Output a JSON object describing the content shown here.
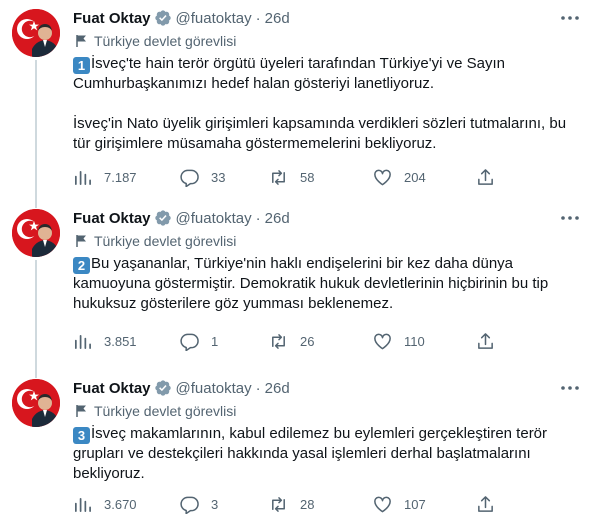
{
  "tweets": [
    {
      "name": "Fuat Oktay",
      "handle": "@fuatoktay",
      "separator": "·",
      "time": "26d",
      "label": "Türkiye devlet görevlisi",
      "number_badge": "1",
      "paragraphs": [
        "İsveç'te hain terör örgütü üyeleri tarafından Türkiye'yi ve Sayın Cumhurbaşkanımızı hedef halan gösteriyi lanetliyoruz.",
        "İsveç'in Nato üyelik girişimleri kapsamında verdikleri sözleri tutmalarını, bu tür girişimlere müsamaha göstermemelerini bekliyoruz."
      ],
      "views": "7.187",
      "replies": "33",
      "retweets": "58",
      "likes": "204"
    },
    {
      "name": "Fuat Oktay",
      "handle": "@fuatoktay",
      "separator": "·",
      "time": "26d",
      "label": "Türkiye devlet görevlisi",
      "number_badge": "2",
      "paragraphs": [
        "Bu yaşananlar, Türkiye'nin haklı endişelerini bir kez daha dünya kamuoyuna göstermiştir. Demokratik hukuk devletlerinin hiçbirinin bu tip hukuksuz gösterilere göz yumması beklenemez."
      ],
      "views": "3.851",
      "replies": "1",
      "retweets": "26",
      "likes": "110"
    },
    {
      "name": "Fuat Oktay",
      "handle": "@fuatoktay",
      "separator": "·",
      "time": "26d",
      "label": "Türkiye devlet görevlisi",
      "number_badge": "3",
      "paragraphs": [
        "İsveç makamlarının, kabul edilemez bu eylemleri gerçekleştiren terör grupları ve destekçileri hakkında yasal işlemleri derhal başlatmalarını bekliyoruz."
      ],
      "views": "3.670",
      "replies": "3",
      "retweets": "28",
      "likes": "107"
    }
  ],
  "icons": {
    "verified": "verified-badge-icon",
    "more": "more-options-icon",
    "label": "government-flag-icon",
    "views": "analytics-icon",
    "reply": "reply-icon",
    "retweet": "retweet-icon",
    "like": "like-icon",
    "share": "share-icon"
  },
  "colors": {
    "verified_badge": "#829aab",
    "number_badge": "#3b88c3",
    "avatar_background": "#d7161e",
    "thread_line": "#cfd9de",
    "secondary_text": "#536471"
  }
}
